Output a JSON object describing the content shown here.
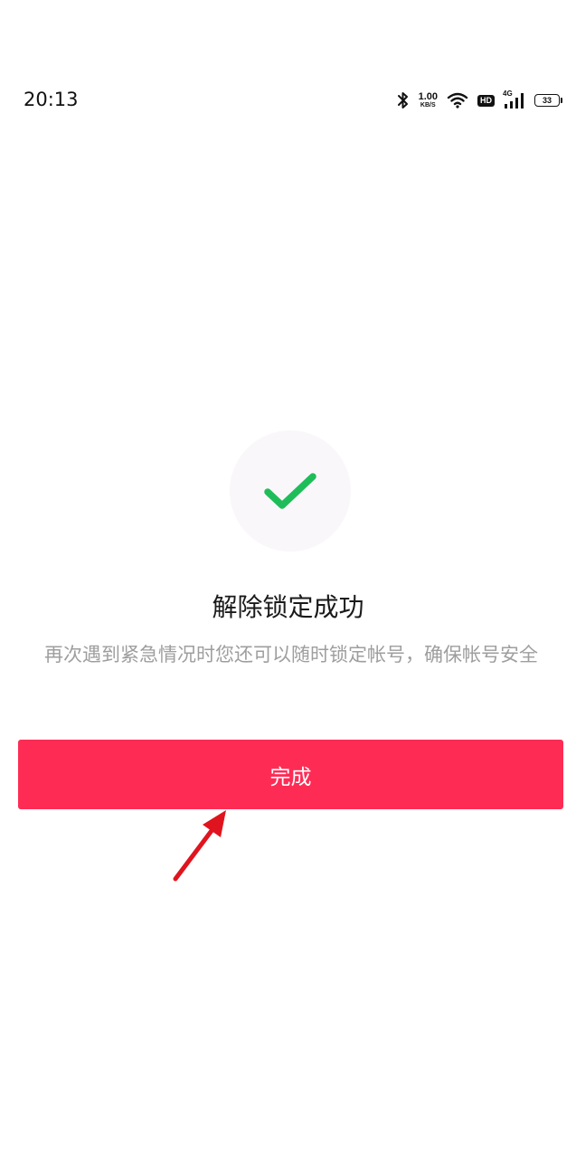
{
  "status_bar": {
    "time": "20:13",
    "net_speed_value": "1.00",
    "net_speed_unit": "KB/S",
    "hd_label": "HD",
    "network_type": "4G",
    "battery_level": "33"
  },
  "result": {
    "icon": "checkmark-icon",
    "title": "解除锁定成功",
    "description": "再次遇到紧急情况时您还可以随时锁定帐号，确保帐号安全"
  },
  "actions": {
    "done_label": "完成"
  },
  "colors": {
    "primary_button": "#fe2c55",
    "check": "#1fbd5a",
    "annotation_arrow": "#e0141e"
  }
}
